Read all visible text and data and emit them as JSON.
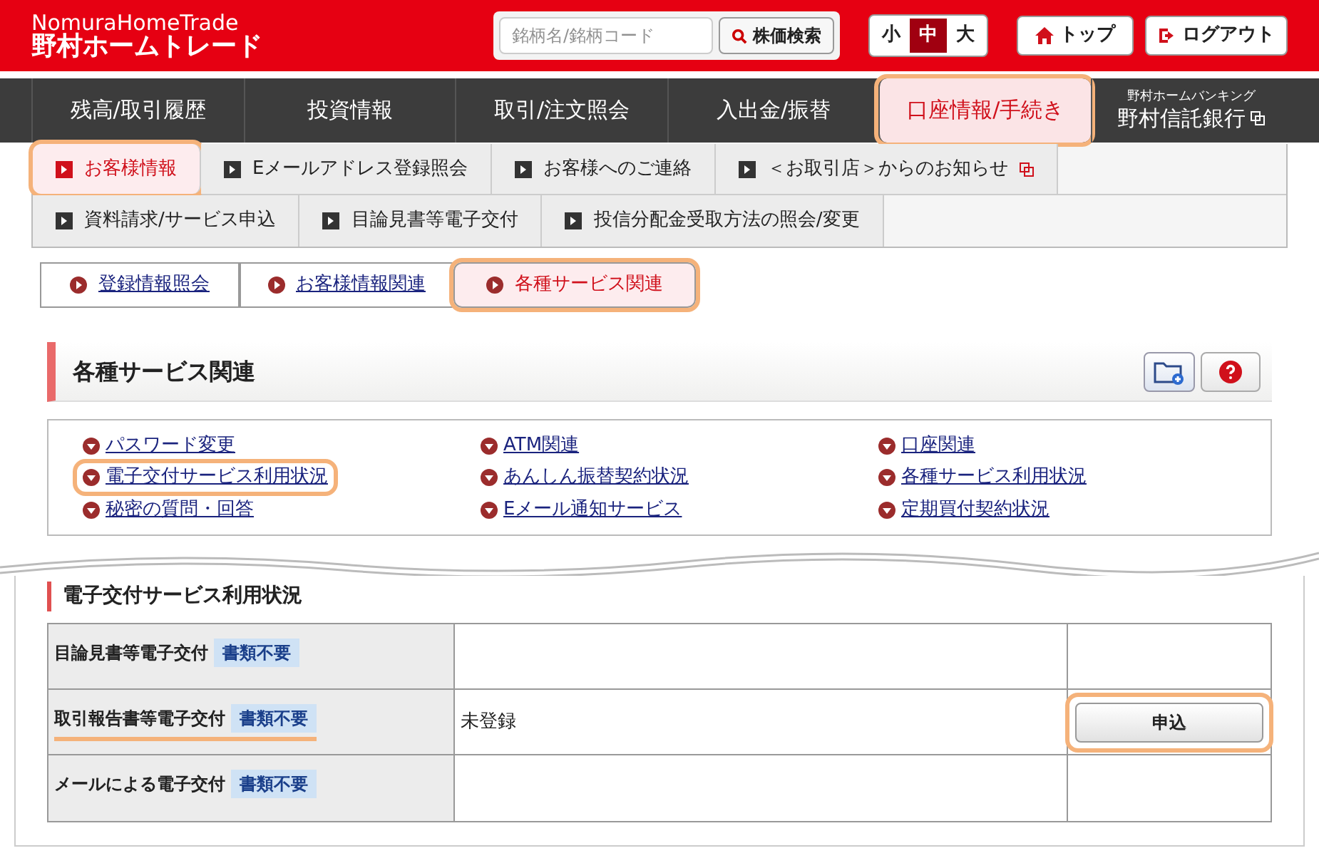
{
  "header": {
    "logo_top": "NomuraHomeTrade",
    "logo_bottom": "野村ホームトレード",
    "search_placeholder": "銘柄名/銘柄コード",
    "search_button": "株価検索",
    "font_sizes": [
      {
        "label": "小",
        "selected": false
      },
      {
        "label": "中",
        "selected": true
      },
      {
        "label": "大",
        "selected": false
      }
    ],
    "top_button": "トップ",
    "logout_button": "ログアウト"
  },
  "nav": {
    "items": [
      {
        "label": "残高/取引履歴",
        "selected": false,
        "highlighted": false
      },
      {
        "label": "投資情報",
        "selected": false,
        "highlighted": false
      },
      {
        "label": "取引/注文照会",
        "selected": false,
        "highlighted": false
      },
      {
        "label": "入出金/振替",
        "selected": false,
        "highlighted": false
      },
      {
        "label": "口座情報/手続き",
        "selected": true,
        "highlighted": true
      }
    ],
    "bank": {
      "caption": "野村ホームバンキング",
      "name": "野村信託銀行"
    }
  },
  "subtabs": [
    [
      {
        "label": "お客様情報",
        "selected": true,
        "highlighted": true,
        "external": false
      },
      {
        "label": "Eメールアドレス登録照会",
        "selected": false,
        "highlighted": false,
        "external": false
      },
      {
        "label": "お客様へのご連絡",
        "selected": false,
        "highlighted": false,
        "external": false
      },
      {
        "label": "＜お取引店＞からのお知らせ",
        "selected": false,
        "highlighted": false,
        "external": true
      }
    ],
    [
      {
        "label": "資料請求/サービス申込",
        "selected": false,
        "highlighted": false,
        "external": false
      },
      {
        "label": "目論見書等電子交付",
        "selected": false,
        "highlighted": false,
        "external": false
      },
      {
        "label": "投信分配金受取方法の照会/変更",
        "selected": false,
        "highlighted": false,
        "external": false
      }
    ]
  ],
  "section_tabs": [
    {
      "label": "登録情報照会",
      "selected": false,
      "highlighted": false
    },
    {
      "label": "お客様情報関連",
      "selected": false,
      "highlighted": false
    },
    {
      "label": "各種サービス関連",
      "selected": true,
      "highlighted": true
    }
  ],
  "panel": {
    "title": "各種サービス関連",
    "links": [
      {
        "label": "パスワード変更",
        "highlighted": false
      },
      {
        "label": "ATM関連",
        "highlighted": false
      },
      {
        "label": "口座関連",
        "highlighted": false
      },
      {
        "label": "電子交付サービス利用状況",
        "highlighted": true
      },
      {
        "label": "あんしん振替契約状況",
        "highlighted": false
      },
      {
        "label": "各種サービス利用状況",
        "highlighted": false
      },
      {
        "label": "秘密の質問・回答",
        "highlighted": false
      },
      {
        "label": "Eメール通知サービス",
        "highlighted": false
      },
      {
        "label": "定期買付契約状況",
        "highlighted": false
      }
    ]
  },
  "status": {
    "title": "電子交付サービス利用状況",
    "rows": [
      {
        "name": "目論見書等電子交付",
        "badge": "書類不要",
        "underlined": false
      },
      {
        "name": "取引報告書等電子交付",
        "badge": "書類不要",
        "underlined": true,
        "value": "未登録",
        "action": {
          "label": "申込",
          "highlighted": true
        }
      },
      {
        "name": "メールによる電子交付",
        "badge": "書類不要",
        "underlined": false
      }
    ]
  }
}
